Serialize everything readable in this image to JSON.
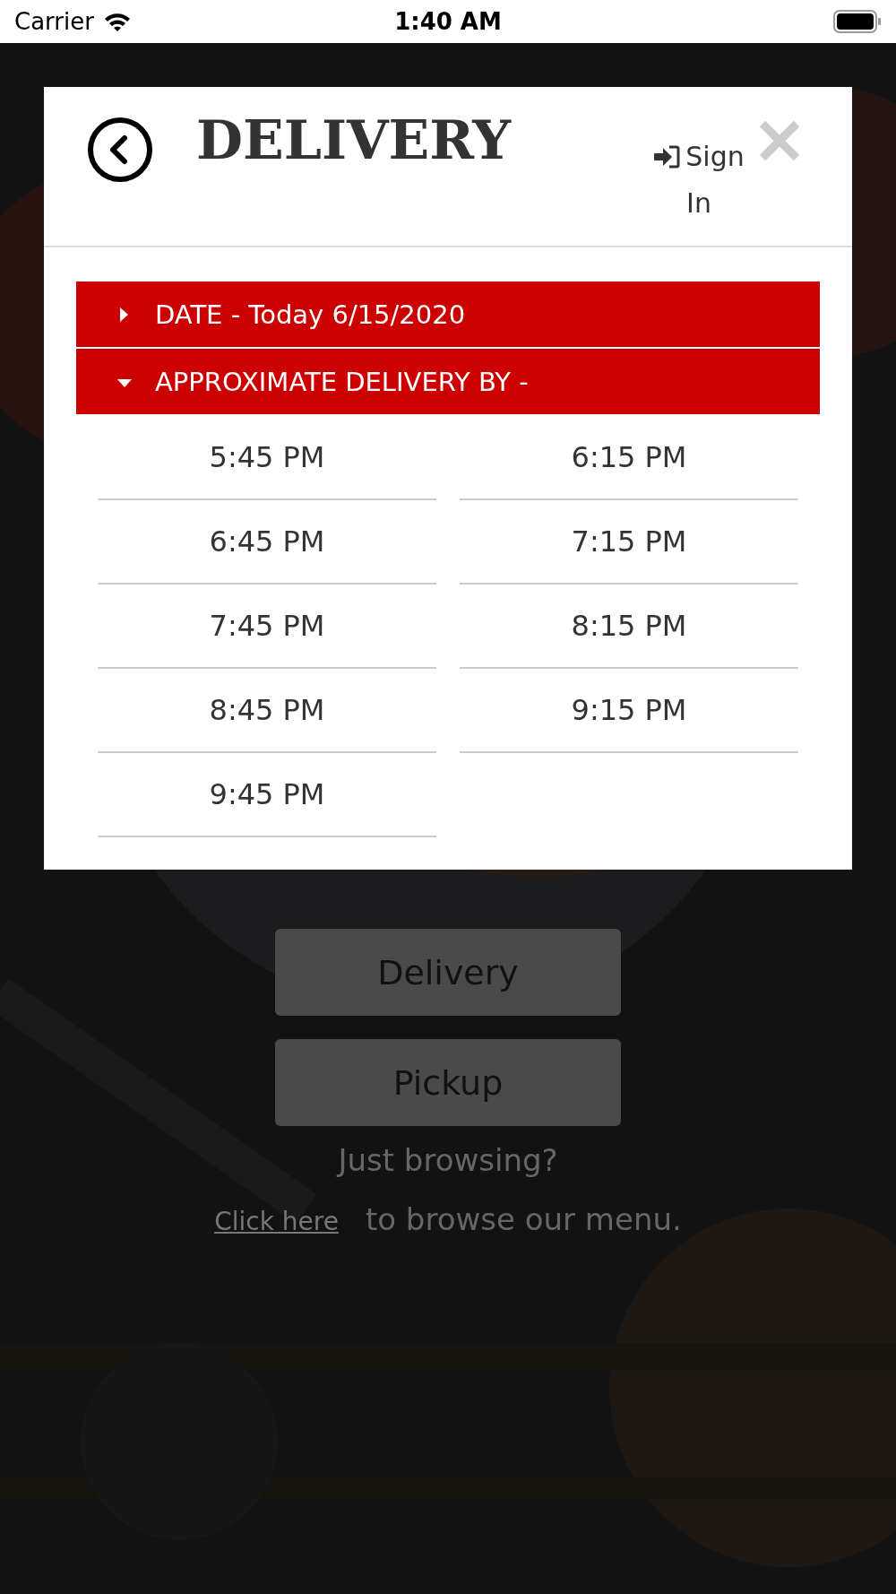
{
  "status_bar": {
    "carrier": "Carrier",
    "time": "1:40 AM"
  },
  "modal": {
    "title": "DELIVERY",
    "sign_in": "Sign In",
    "sections": [
      {
        "label": "DATE - Today 6/15/2020",
        "expanded": false
      },
      {
        "label": "APPROXIMATE DELIVERY BY -",
        "expanded": true
      }
    ],
    "times": [
      "5:45 PM",
      "6:15 PM",
      "6:45 PM",
      "7:15 PM",
      "7:45 PM",
      "8:15 PM",
      "8:45 PM",
      "9:15 PM",
      "9:45 PM"
    ]
  },
  "page": {
    "buttons": [
      "Delivery",
      "Pickup"
    ],
    "browse_prompt": "Just browsing?",
    "link": "Click here",
    "link_rest": "to browse our menu."
  }
}
